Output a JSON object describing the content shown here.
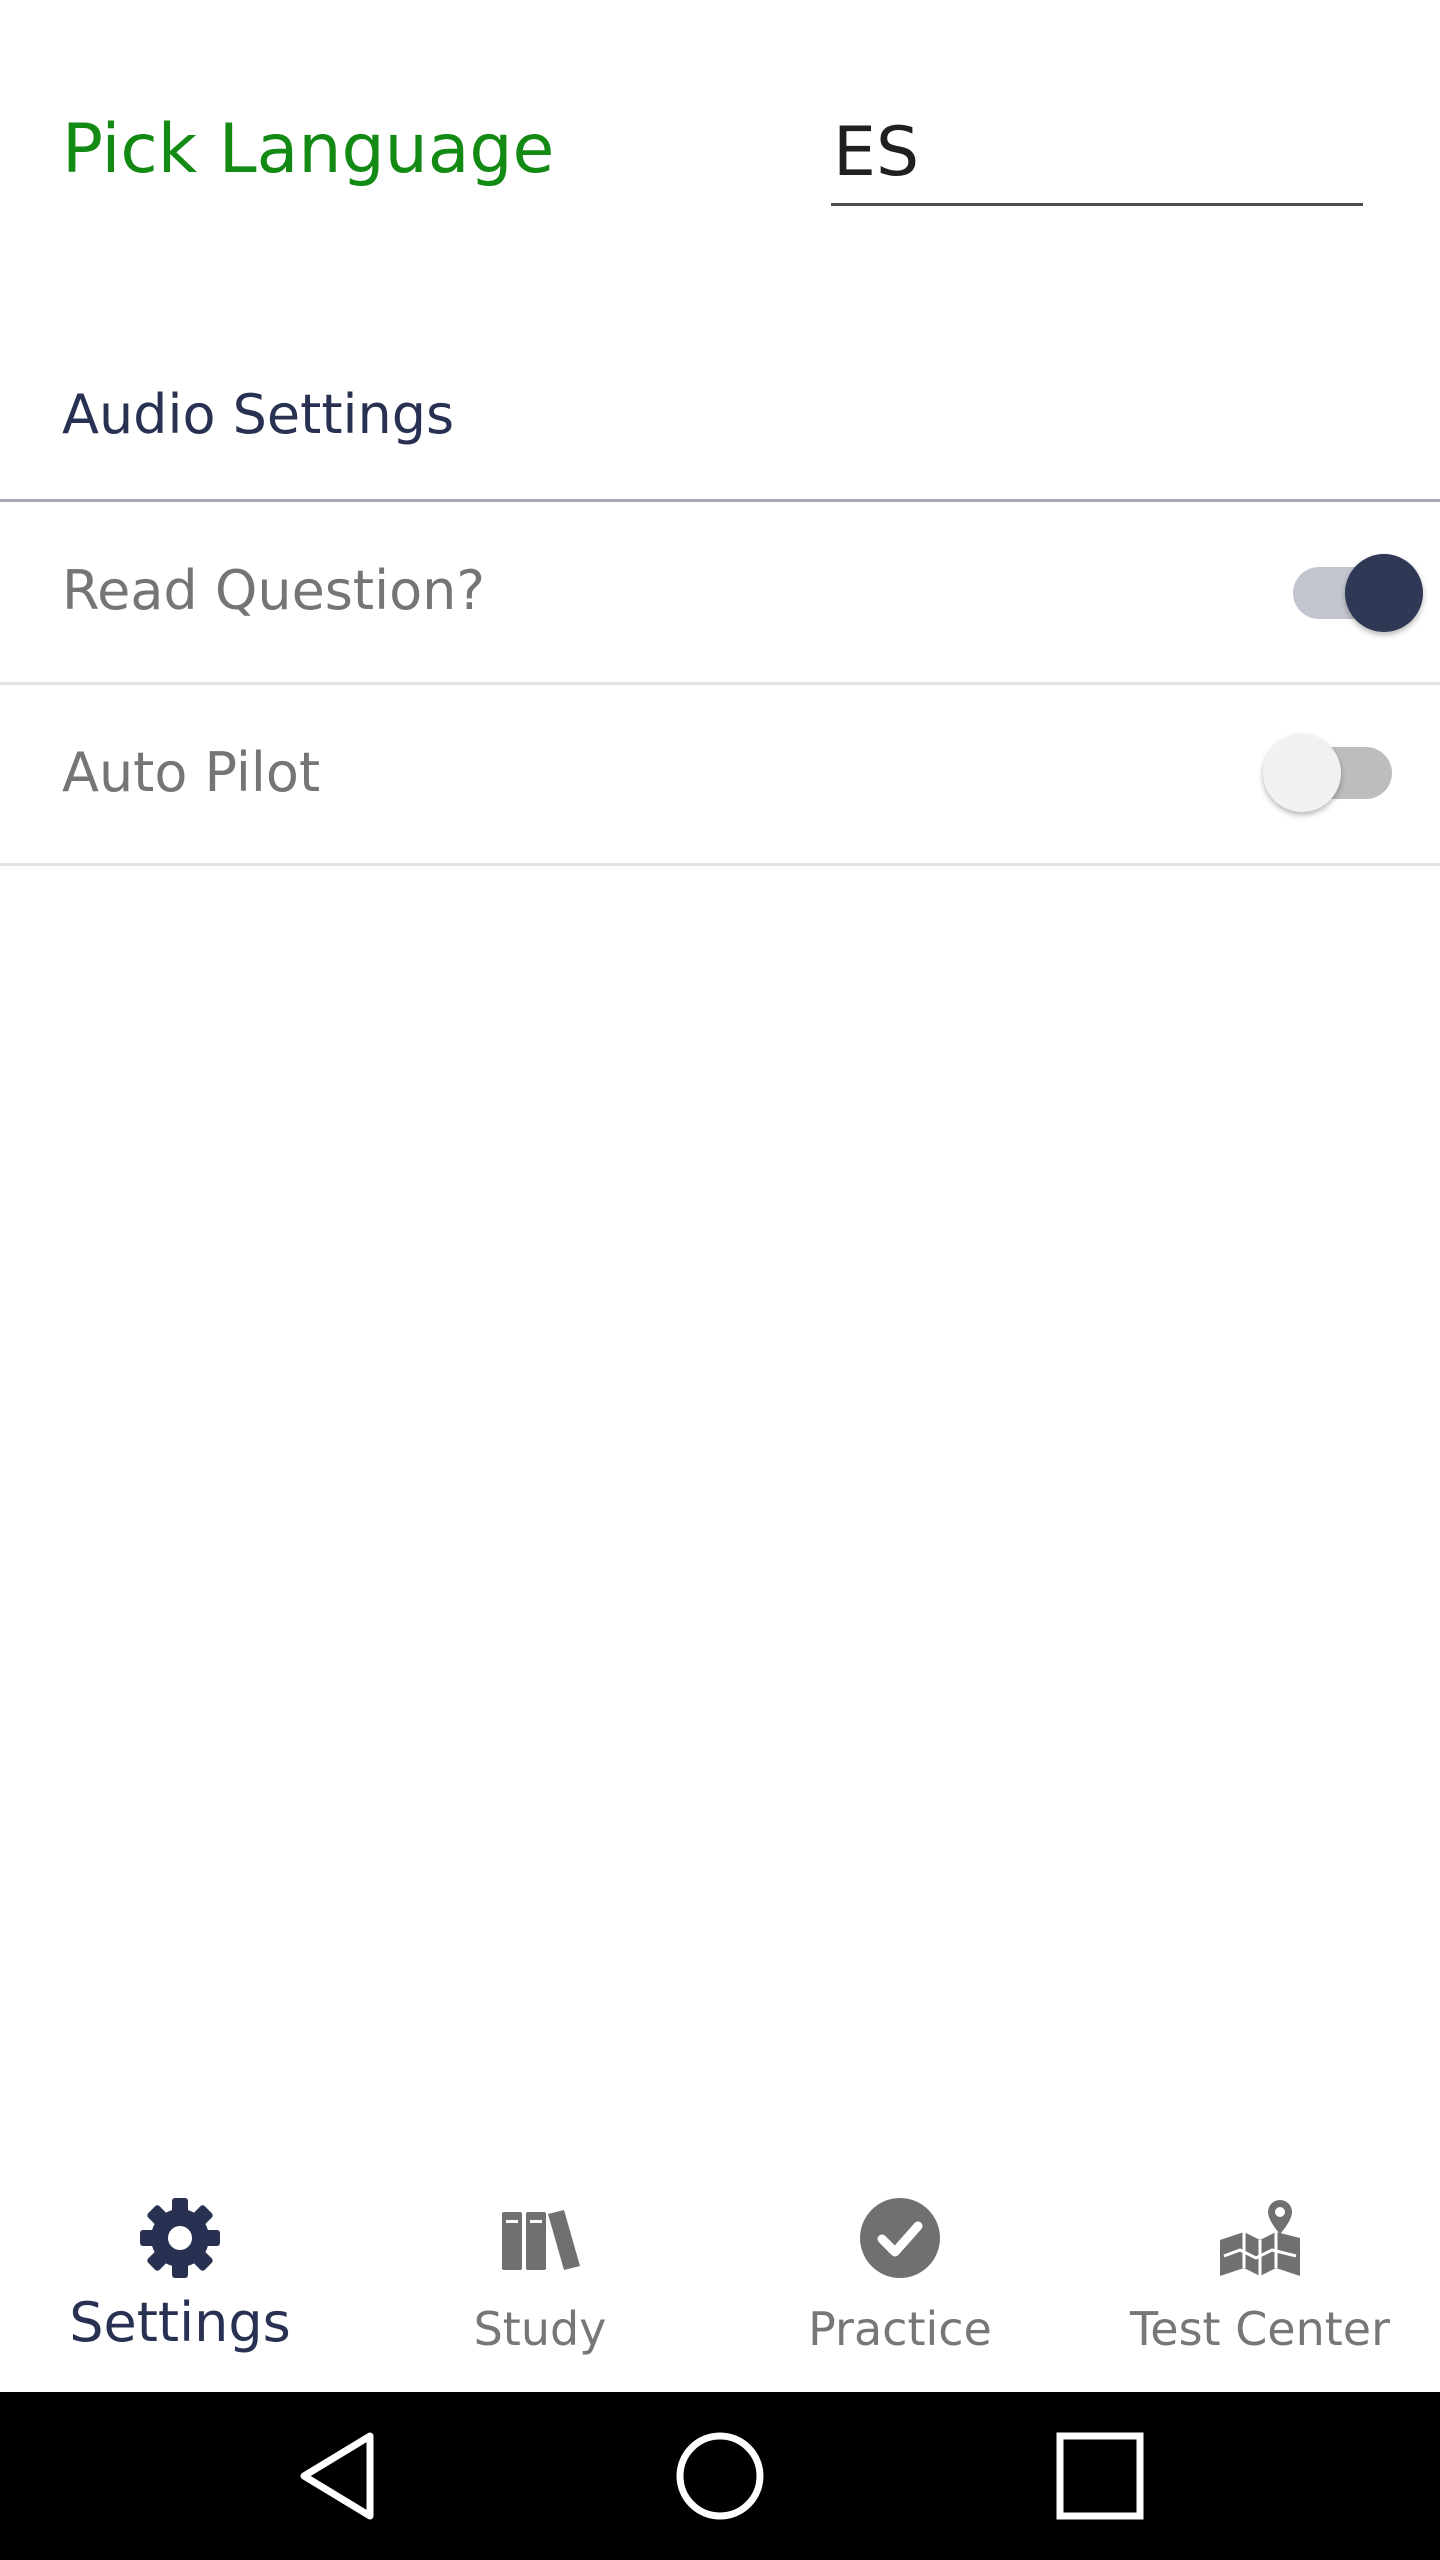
{
  "language": {
    "label": "Pick Language",
    "value": "ES"
  },
  "audio_settings": {
    "title": "Audio Settings",
    "items": [
      {
        "label": "Read Question?",
        "enabled": true
      },
      {
        "label": "Auto Pilot",
        "enabled": false
      }
    ]
  },
  "bottom_nav": {
    "active_color": "#283152",
    "inactive_color": "#777777",
    "items": [
      {
        "label": "Settings",
        "icon": "gear-icon",
        "active": true
      },
      {
        "label": "Study",
        "icon": "books-icon",
        "active": false
      },
      {
        "label": "Practice",
        "icon": "check-circle-icon",
        "active": false
      },
      {
        "label": "Test Center",
        "icon": "map-pin-icon",
        "active": false
      }
    ]
  },
  "system_nav": {
    "buttons": [
      "back-icon",
      "home-icon",
      "recents-icon"
    ]
  },
  "colors": {
    "accent_green": "#138a13",
    "toggle_on_thumb": "#2f3855",
    "toggle_on_track": "#c3c6cf",
    "toggle_off_thumb": "#f1f1f1",
    "toggle_off_track": "#bdbdbd"
  }
}
